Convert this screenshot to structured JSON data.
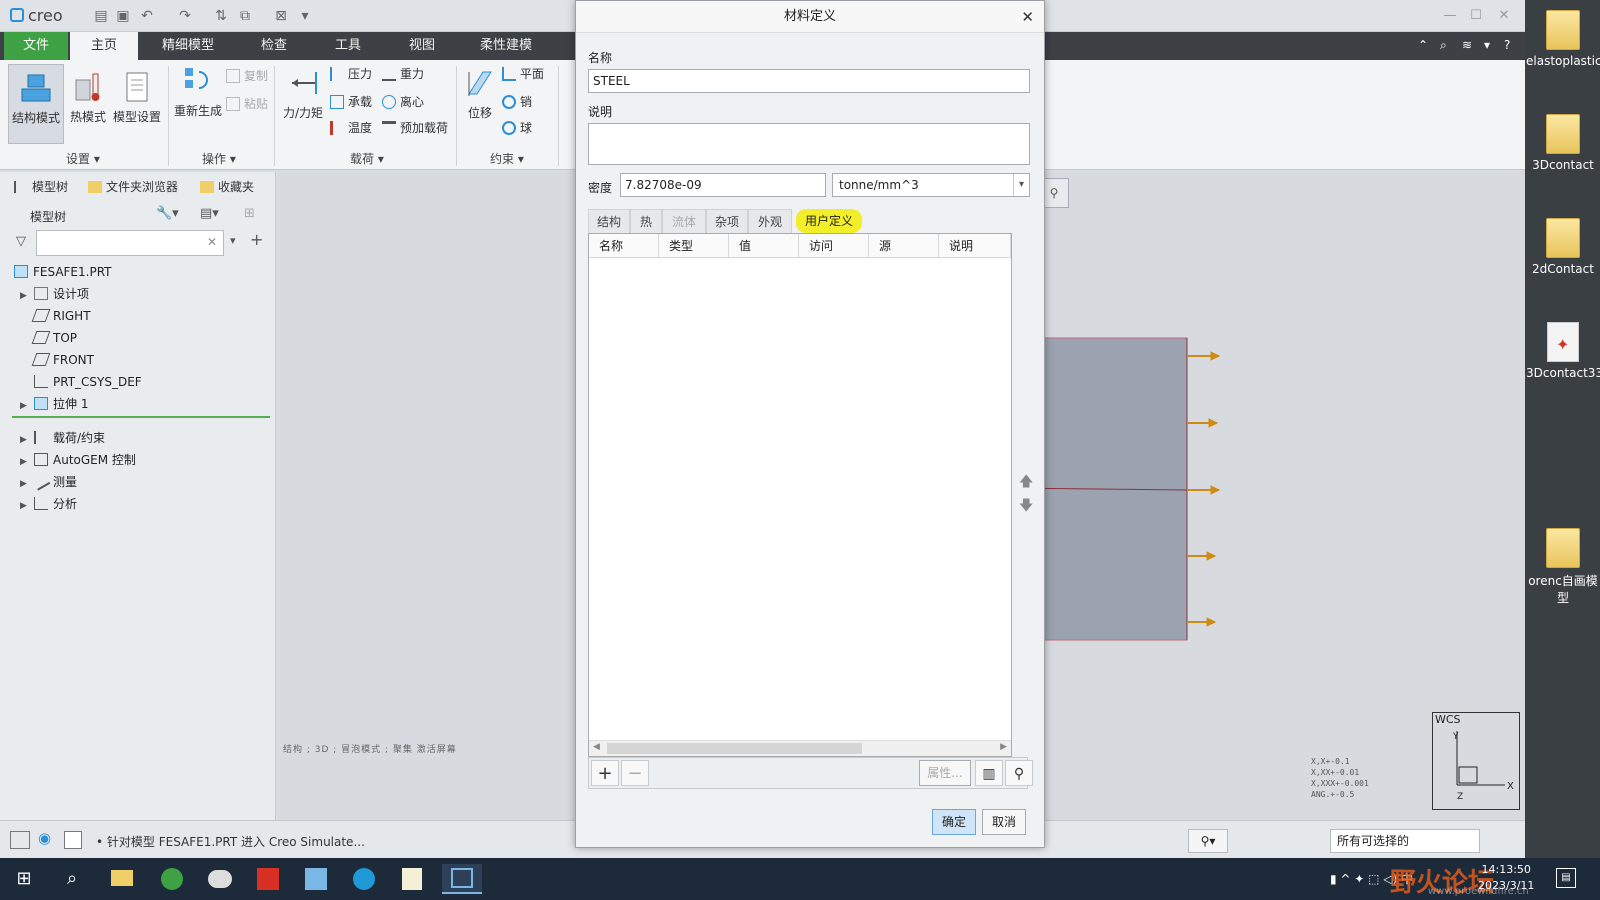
{
  "app": {
    "logo": "creo",
    "ribbon_tabs": [
      "文件",
      "主页",
      "精细模型",
      "检查",
      "工具",
      "视图",
      "柔性建模"
    ],
    "ribbon": {
      "structure_mode": "结构模式",
      "thermal_mode": "热模式",
      "model_setup": "模型设置",
      "regenerate": "重新生成",
      "copy": "复制",
      "paste": "粘贴",
      "force_moment": "力/力矩",
      "pressure": "压力",
      "gravity": "重力",
      "bearing": "承载",
      "centrifugal": "离心",
      "temperature": "温度",
      "preload": "预加载荷",
      "displacement": "位移",
      "plane": "平面",
      "pin": "销",
      "ball": "球",
      "group_setup": "设置",
      "group_operations": "操作",
      "group_loads": "载荷",
      "group_constraints": "约束"
    },
    "panel_tabs": [
      "模型树",
      "文件夹浏览器",
      "收藏夹"
    ],
    "tree_header": "模型树",
    "tree": {
      "root": "FESAFE1.PRT",
      "items": [
        "设计项",
        "RIGHT",
        "TOP",
        "FRONT",
        "PRT_CSYS_DEF",
        "拉伸 1"
      ],
      "sim_items": [
        "载荷/约束",
        "AutoGEM 控制",
        "测量",
        "分析"
      ]
    },
    "gfx_tiny_text": "结构 ; 3D ; 冒泡模式 ; 聚集 激活屏幕",
    "wcs_label": "WCS",
    "coord_readout": [
      "X,X+-0.1",
      "X,XX+-0.01",
      "X,XXX+-0.001",
      "ANG.+-0.5"
    ],
    "status_message": "• 针对模型 FESAFE1.PRT 进入 Creo Simulate...",
    "selection_filter": "所有可选择的"
  },
  "dialog": {
    "title": "材料定义",
    "name_label": "名称",
    "name_value": "STEEL",
    "desc_label": "说明",
    "desc_value": "",
    "density_label": "密度",
    "density_value": "7.82708e-09",
    "density_unit": "tonne/mm^3",
    "tabs": [
      "结构",
      "热",
      "流体",
      "杂项",
      "外观",
      "用户定义"
    ],
    "columns": [
      "名称",
      "类型",
      "值",
      "访问",
      "源",
      "说明"
    ],
    "properties_button": "属性...",
    "ok": "确定",
    "cancel": "取消"
  },
  "desktop": {
    "icons": [
      "elastoplastic",
      "3Dcontact",
      "2dContact",
      "3Dcontact33",
      "orenc自画模型"
    ]
  },
  "taskbar": {
    "time": "14:13:50",
    "date": "2023/3/11",
    "watermark": "野火论坛",
    "watermark_url": "www.proewildfire.cn"
  },
  "colors": {
    "accent_green": "#3ea144",
    "active_tab_highlight": "#f3ee2a",
    "model_fill": "#9aa3af",
    "arrow": "#d08a16"
  }
}
